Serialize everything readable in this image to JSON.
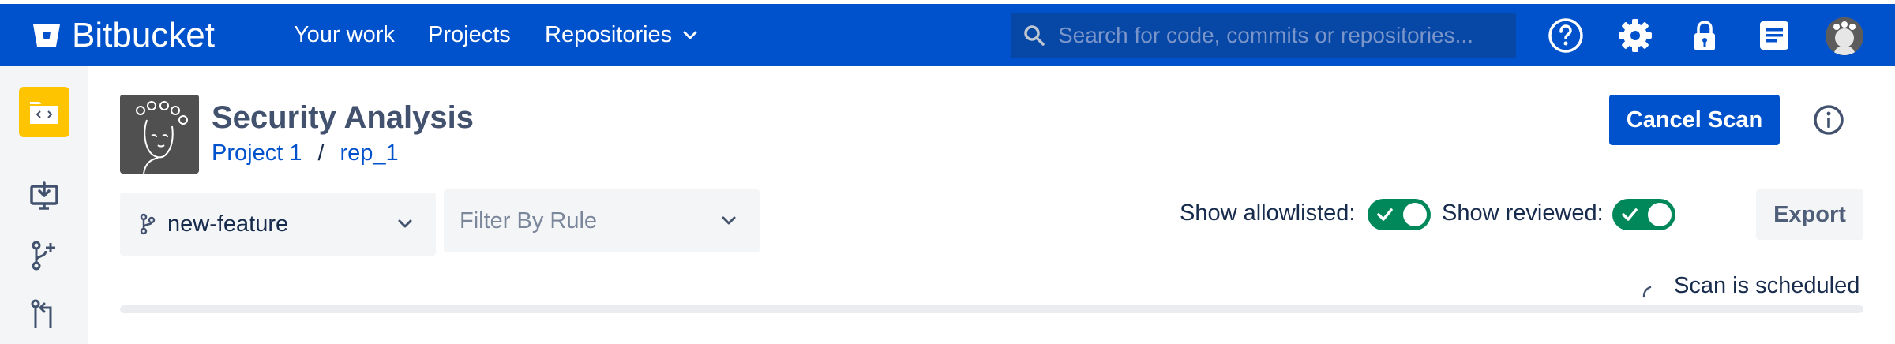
{
  "app": {
    "name": "Bitbucket"
  },
  "nav": {
    "your_work": "Your work",
    "projects": "Projects",
    "repositories": "Repositories"
  },
  "search": {
    "placeholder": "Search for code, commits or repositories..."
  },
  "header_icons": [
    "help-icon",
    "gear-icon",
    "lock-icon",
    "notes-icon",
    "avatar"
  ],
  "sidebar": {
    "repo_avatar_icon": "code-folder-icon",
    "items": [
      "clone-icon",
      "create-branch-icon",
      "pull-request-icon"
    ]
  },
  "page": {
    "title": "Security Analysis",
    "project": "Project 1",
    "separator": "/",
    "repo": "rep_1"
  },
  "actions": {
    "cancel_scan": "Cancel Scan",
    "export": "Export"
  },
  "filters": {
    "branch": "new-feature",
    "rule_placeholder": "Filter By Rule"
  },
  "toggles": {
    "allowlisted_label": "Show allowlisted:",
    "allowlisted_on": true,
    "reviewed_label": "Show reviewed:",
    "reviewed_on": true
  },
  "scan": {
    "status": "Scan is scheduled",
    "progress": 0
  },
  "colors": {
    "brand": "#0052cc",
    "toggle_on": "#00875a",
    "repo_avatar": "#ffc400"
  }
}
